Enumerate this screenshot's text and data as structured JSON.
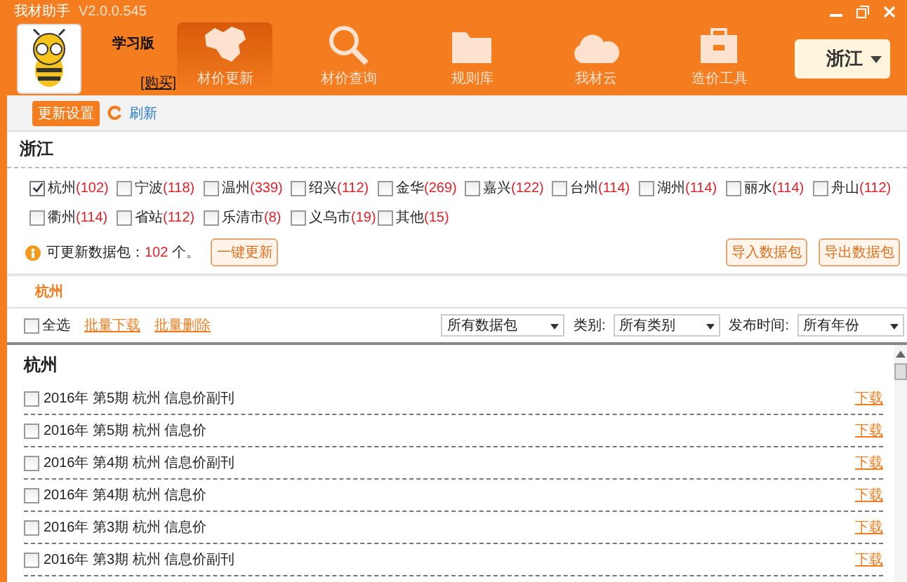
{
  "window": {
    "title": "我材助手",
    "version": "V2.0.0.545"
  },
  "header": {
    "edition": "学习版",
    "buy_link": "[购买]",
    "region_select": "浙江",
    "nav": [
      {
        "label": "材价更新",
        "selected": true
      },
      {
        "label": "材价查询",
        "selected": false
      },
      {
        "label": "规则库",
        "selected": false
      },
      {
        "label": "我材云",
        "selected": false
      },
      {
        "label": "造价工具",
        "selected": false
      }
    ]
  },
  "toolbar": {
    "settings_button": "更新设置",
    "refresh_link": "刷新"
  },
  "region": {
    "title": "浙江",
    "cities": [
      {
        "name": "杭州",
        "count": "(102)",
        "checked": true
      },
      {
        "name": "宁波",
        "count": "(118)",
        "checked": false
      },
      {
        "name": "温州",
        "count": "(339)",
        "checked": false
      },
      {
        "name": "绍兴",
        "count": "(112)",
        "checked": false
      },
      {
        "name": "金华",
        "count": "(269)",
        "checked": false
      },
      {
        "name": "嘉兴",
        "count": "(122)",
        "checked": false
      },
      {
        "name": "台州",
        "count": "(114)",
        "checked": false
      },
      {
        "name": "湖州",
        "count": "(114)",
        "checked": false
      },
      {
        "name": "丽水",
        "count": "(114)",
        "checked": false
      },
      {
        "name": "舟山",
        "count": "(112)",
        "checked": false
      },
      {
        "name": "衢州",
        "count": "(114)",
        "checked": false
      },
      {
        "name": "省站",
        "count": "(112)",
        "checked": false
      },
      {
        "name": "乐清市",
        "count": "(8)",
        "checked": false
      },
      {
        "name": "义乌市",
        "count": "(19)",
        "checked": false
      },
      {
        "name": "其他",
        "count": "(15)",
        "checked": false
      }
    ],
    "update_label": "可更新数据包：",
    "update_count": "102",
    "update_unit": "个。",
    "update_all_button": "一键更新",
    "import_button": "导入数据包",
    "export_button": "导出数据包"
  },
  "city_tabs": [
    {
      "label": "杭州",
      "selected": true
    }
  ],
  "filters": {
    "select_all": {
      "label": "全选",
      "checked": false
    },
    "batch_download": "批量下载",
    "batch_delete": "批量删除",
    "package": "所有数据包",
    "category_label": "类别:",
    "category": "所有类别",
    "time_label": "发布时间:",
    "time": "所有年份"
  },
  "list": {
    "group": "杭州",
    "rows": [
      {
        "title": "2016年 第5期 杭州 信息价副刊",
        "action": "下载",
        "checked": false
      },
      {
        "title": "2016年 第5期 杭州 信息价",
        "action": "下载",
        "checked": false
      },
      {
        "title": "2016年 第4期 杭州 信息价副刊",
        "action": "下载",
        "checked": false
      },
      {
        "title": "2016年 第4期 杭州 信息价",
        "action": "下载",
        "checked": false
      },
      {
        "title": "2016年 第3期 杭州 信息价",
        "action": "下载",
        "checked": false
      },
      {
        "title": "2016年 第3期 杭州 信息价副刊",
        "action": "下载",
        "checked": false
      }
    ]
  }
}
